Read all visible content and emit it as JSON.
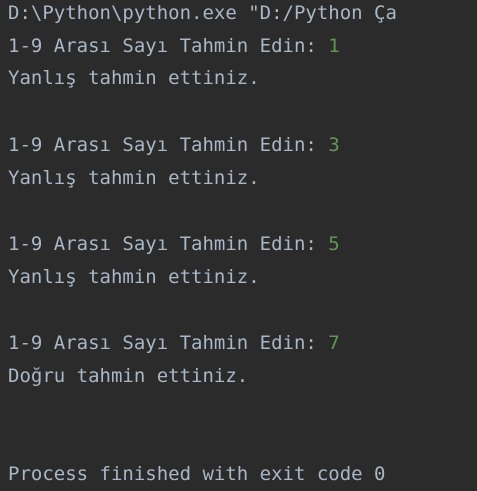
{
  "console": {
    "command": "D:\\Python\\python.exe \"D:/Python Ça",
    "rounds": [
      {
        "prompt": "1-9 Arası Sayı Tahmin Edin: ",
        "input": "1",
        "result": "Yanlış tahmin ettiniz."
      },
      {
        "prompt": "1-9 Arası Sayı Tahmin Edin: ",
        "input": "3",
        "result": "Yanlış tahmin ettiniz."
      },
      {
        "prompt": "1-9 Arası Sayı Tahmin Edin: ",
        "input": "5",
        "result": "Yanlış tahmin ettiniz."
      },
      {
        "prompt": "1-9 Arası Sayı Tahmin Edin: ",
        "input": "7",
        "result": "Doğru tahmin ettiniz."
      }
    ],
    "exit_message": "Process finished with exit code 0"
  },
  "colors": {
    "background": "#2b2b2b",
    "text": "#a9b7c6",
    "user_input": "#629755"
  }
}
